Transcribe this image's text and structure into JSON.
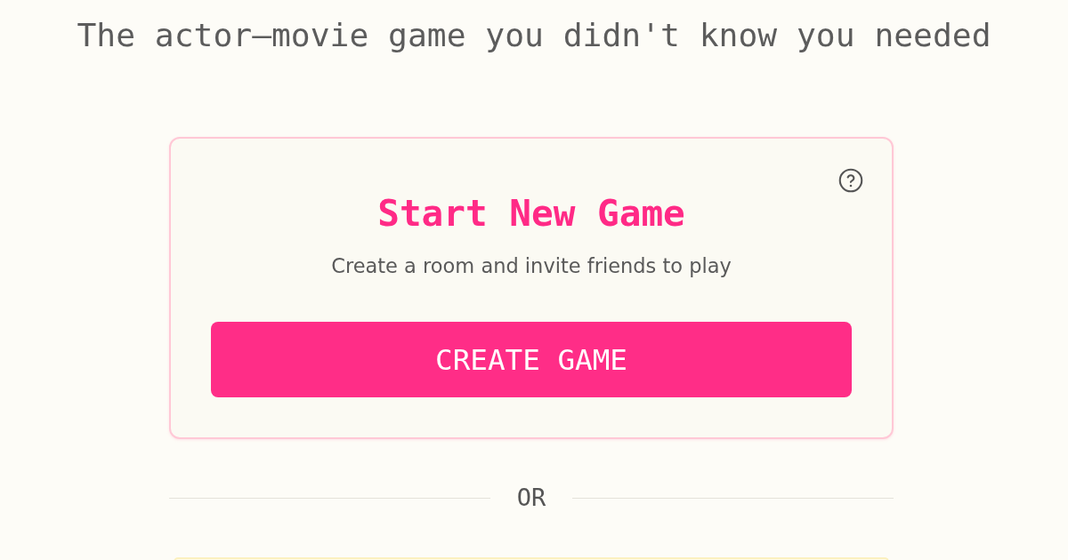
{
  "header": {
    "tagline": "The actor—movie game you didn't know you needed"
  },
  "new_game_card": {
    "title": "Start New Game",
    "subtitle": "Create a room and invite friends to play",
    "button": "CREATE GAME"
  },
  "divider": {
    "label": "OR"
  }
}
